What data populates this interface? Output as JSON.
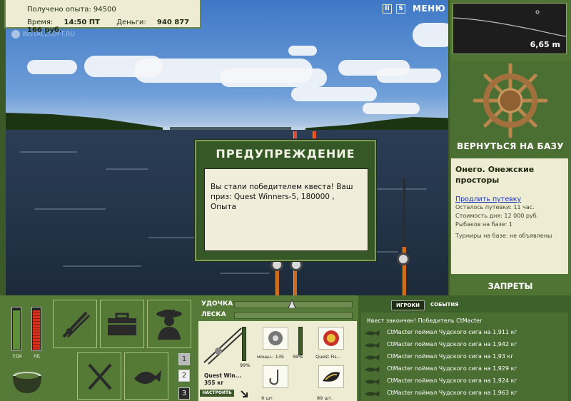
{
  "status": {
    "experience_label": "Получено опыта:",
    "experience_value": "94500",
    "time_label": "Время:",
    "time_value": "14:50 ПТ",
    "money_label": "Деньги:",
    "money_value": "940 877 166 руб."
  },
  "watermark": "INSTALLSOFT.RU",
  "top_buttons": {
    "pause": "II",
    "settings": "S",
    "menu": "МЕНЮ"
  },
  "depth": {
    "value": "6,65 m"
  },
  "right_panel": {
    "return_button": "ВЕРНУТЬСЯ НА БАЗУ",
    "location_name": "Онего. Онежские просторы",
    "extend_link": "Продлить путевку",
    "voucher_left": "Осталось путевки: 11 час.",
    "day_cost": "Стоимость дня: 12 000 руб.",
    "anglers": "Рыбаков на базе: 1",
    "tournaments": "Турниры на базе: не объявлены",
    "bans_button": "ЗАПРЕТЫ"
  },
  "dialog": {
    "title": "ПРЕДУПРЕЖДЕНИЕ",
    "message": "Вы стали победителем квеста! Ваш приз: Quest Winners-5, 180000 , Опыта"
  },
  "meters": {
    "food_label": "ЕДА",
    "drink_label": "ЯД",
    "food_level": 0.95,
    "drink_level": 0.95
  },
  "page_buttons": [
    "1",
    "2",
    "3"
  ],
  "tension": {
    "rod_label": "УДОЧКА",
    "line_label": "ЛЕСКА"
  },
  "slots": {
    "rod_name": "Quest Win...",
    "rod_weight": "355 кг",
    "rod_pct": "99%",
    "reel_label": "мощн.: 135",
    "reel_pct": "99%",
    "bait_label": "Quest Fis...",
    "hook_label": "9 шт.",
    "lure_label": "89 шт.",
    "setup_button": "НАСТРОИТЬ"
  },
  "events": {
    "tabs": [
      "ИГРОКИ",
      "СОБЫТИЯ"
    ],
    "header": "Квест закончен! Победитель CtMacter",
    "items": [
      "CtMacter поймал Чудского сига на 1,911 кг",
      "CtMacter поймал Чудского сига на 1,942 кг",
      "CtMacter поймал Чудского сига на 1,93 кг",
      "CtMacter поймал Чудского сига на 1,929 кг",
      "CtMacter поймал Чудского сига на 1,924 кг",
      "CtMacter поймал Чудского сига на 1,963 кг"
    ]
  },
  "colors": {
    "panel_green": "#567b39",
    "paper": "#eeecd2",
    "rod_orange": "#d0691c",
    "meter_red": "#d8301c",
    "meter_green": "#5f8e3b"
  }
}
